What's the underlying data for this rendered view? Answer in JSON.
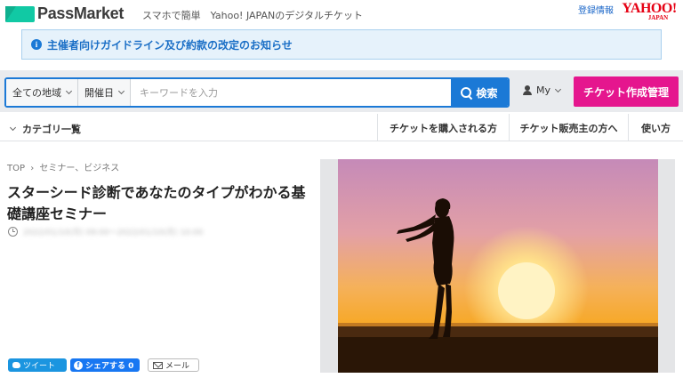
{
  "header": {
    "logo_text": "PassMarket",
    "tagline": "スマホで簡単　Yahoo! JAPANのデジタルチケット",
    "register_link": "登録情報",
    "yahoo_logo": "YAHOO!",
    "yahoo_logo_sub": "JAPAN"
  },
  "notice": {
    "text": "主催者向けガイドライン及び約款の改定のお知らせ",
    "icon": "info-icon"
  },
  "search": {
    "region_label": "全ての地域",
    "date_label": "開催日",
    "keyword_placeholder": "キーワードを入力",
    "keyword_value": "",
    "search_button": "検索",
    "my_label": "My",
    "create_ticket_button": "チケット作成管理"
  },
  "nav": {
    "category_list": "カテゴリ一覧",
    "links": [
      "チケットを購入される方",
      "チケット販売主の方へ",
      "使い方"
    ]
  },
  "event": {
    "breadcrumb": [
      "TOP",
      "セミナー、ビジネス"
    ],
    "breadcrumb_separator": "›",
    "title": "スターシード診断であなたのタイプがわかる基礎講座セミナー",
    "date_text": "2022/01/10(月) 09:00〜2022/01/10(月) 10:00"
  },
  "share": {
    "tweet": "ツイート",
    "facebook": "シェアする 0",
    "mail": "メール"
  },
  "colors": {
    "brand_green": "#11c9a4",
    "link_blue": "#1b79d6",
    "accent_pink": "#e5168e",
    "yahoo_red": "#e60013",
    "twitter_blue": "#1b95e0",
    "facebook_blue": "#1877f2"
  }
}
